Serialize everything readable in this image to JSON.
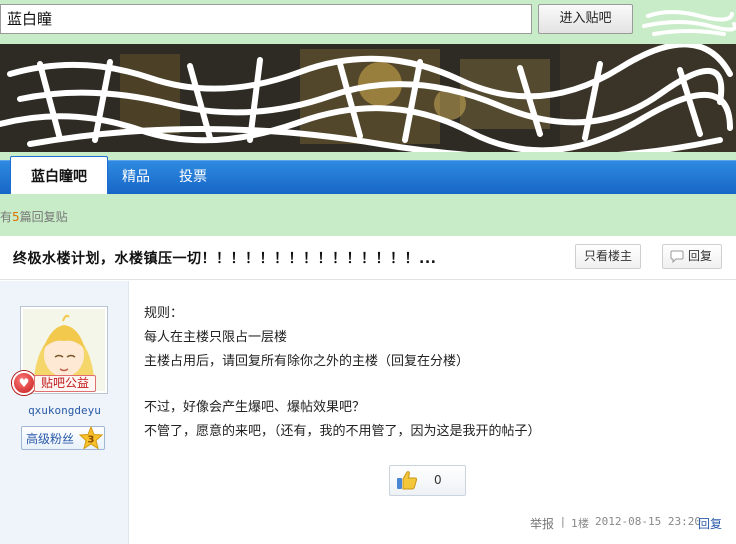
{
  "search": {
    "value": "蓝白瞳",
    "enter_label": "进入贴吧"
  },
  "nav": {
    "tabs": [
      "蓝白瞳吧",
      "精品",
      "投票"
    ]
  },
  "reply_count": {
    "prefix": "有",
    "count": "5",
    "suffix": "篇回复贴"
  },
  "thread": {
    "title": "终极水楼计划，水楼镇压一切！！！！！！！！！！！！！！！...",
    "only_op_label": "只看楼主",
    "reply_label": "回复"
  },
  "author": {
    "badge_label": "贴吧公益",
    "username": "qxukongdeyu",
    "level_label": "高级粉丝",
    "level_number": "3"
  },
  "post": {
    "lines": [
      "规则：",
      "每人在主楼只限占一层楼",
      "主楼占用后，请回复所有除你之外的主楼（回复在分楼）",
      "",
      "不过，好像会产生爆吧、爆帖效果吧？",
      "不管了，愿意的来吧，（还有，我的不用管了，因为这是我开的帖子）"
    ],
    "like_count": "0",
    "report_label": "举报",
    "separator": "|",
    "floor": "1楼",
    "timestamp": "2012-08-15 23:20",
    "reply_label": "回复"
  },
  "colors": {
    "green_bg": "#c8ecc8",
    "nav_blue": "#1f77d6",
    "accent_orange": "#e07000",
    "link_blue": "#2a5aa8"
  }
}
